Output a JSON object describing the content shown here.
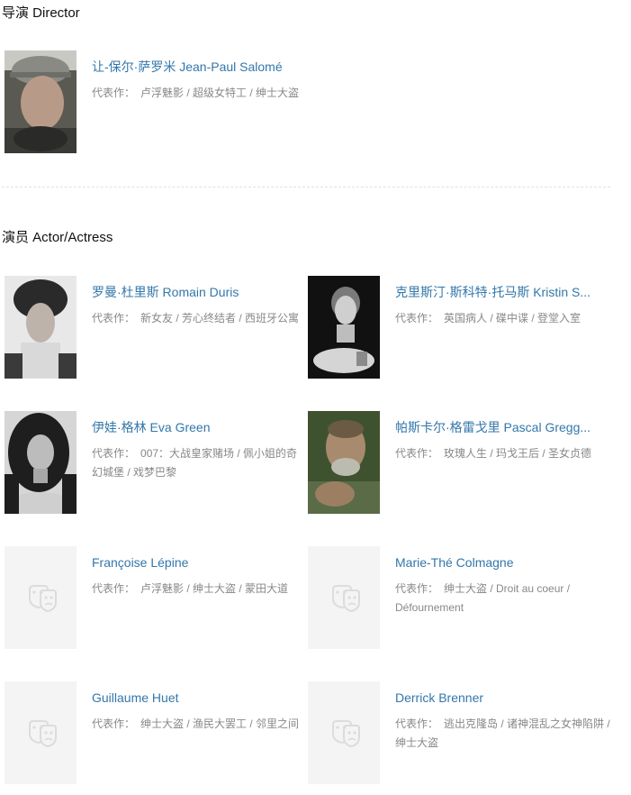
{
  "director_section": {
    "title": "导演 Director"
  },
  "actor_section": {
    "title": "演员 Actor/Actress"
  },
  "works_label": "代表作：",
  "director": {
    "name": "让-保尔·萨罗米 Jean-Paul Salomé",
    "works": "卢浮魅影 / 超级女特工 / 绅士大盗",
    "photo": "portrait-photo"
  },
  "actors": [
    {
      "name": "罗曼·杜里斯 Romain Duris",
      "works": "新女友 / 芳心终结者 / 西班牙公寓",
      "photo": "portrait-photo"
    },
    {
      "name": "克里斯汀·斯科特·托马斯 Kristin S...",
      "works": "英国病人 / 碟中谍 / 登堂入室",
      "photo": "portrait-photo"
    },
    {
      "name": "伊娃·格林 Eva Green",
      "works": "007：大战皇家赌场 / 佩小姐的奇幻城堡 / 戏梦巴黎",
      "photo": "portrait-photo"
    },
    {
      "name": "帕斯卡尔·格雷戈里 Pascal Gregg...",
      "works": "玫瑰人生 / 玛戈王后 / 圣女贞德",
      "photo": "portrait-photo"
    },
    {
      "name": "Françoise Lépine",
      "works": "卢浮魅影 / 绅士大盗 / 蒙田大道",
      "photo": "theater-mask-icon"
    },
    {
      "name": "Marie-Thé Colmagne",
      "works": "绅士大盗 / Droit au coeur / Défournement",
      "photo": "theater-mask-icon"
    },
    {
      "name": "Guillaume Huet",
      "works": "绅士大盗 / 渔民大罢工 / 邻里之间",
      "photo": "theater-mask-icon"
    },
    {
      "name": "Derrick Brenner",
      "works": "逃出克隆岛 / 诸神混乱之女神陷阱 / 绅士大盗",
      "photo": "theater-mask-icon"
    }
  ]
}
